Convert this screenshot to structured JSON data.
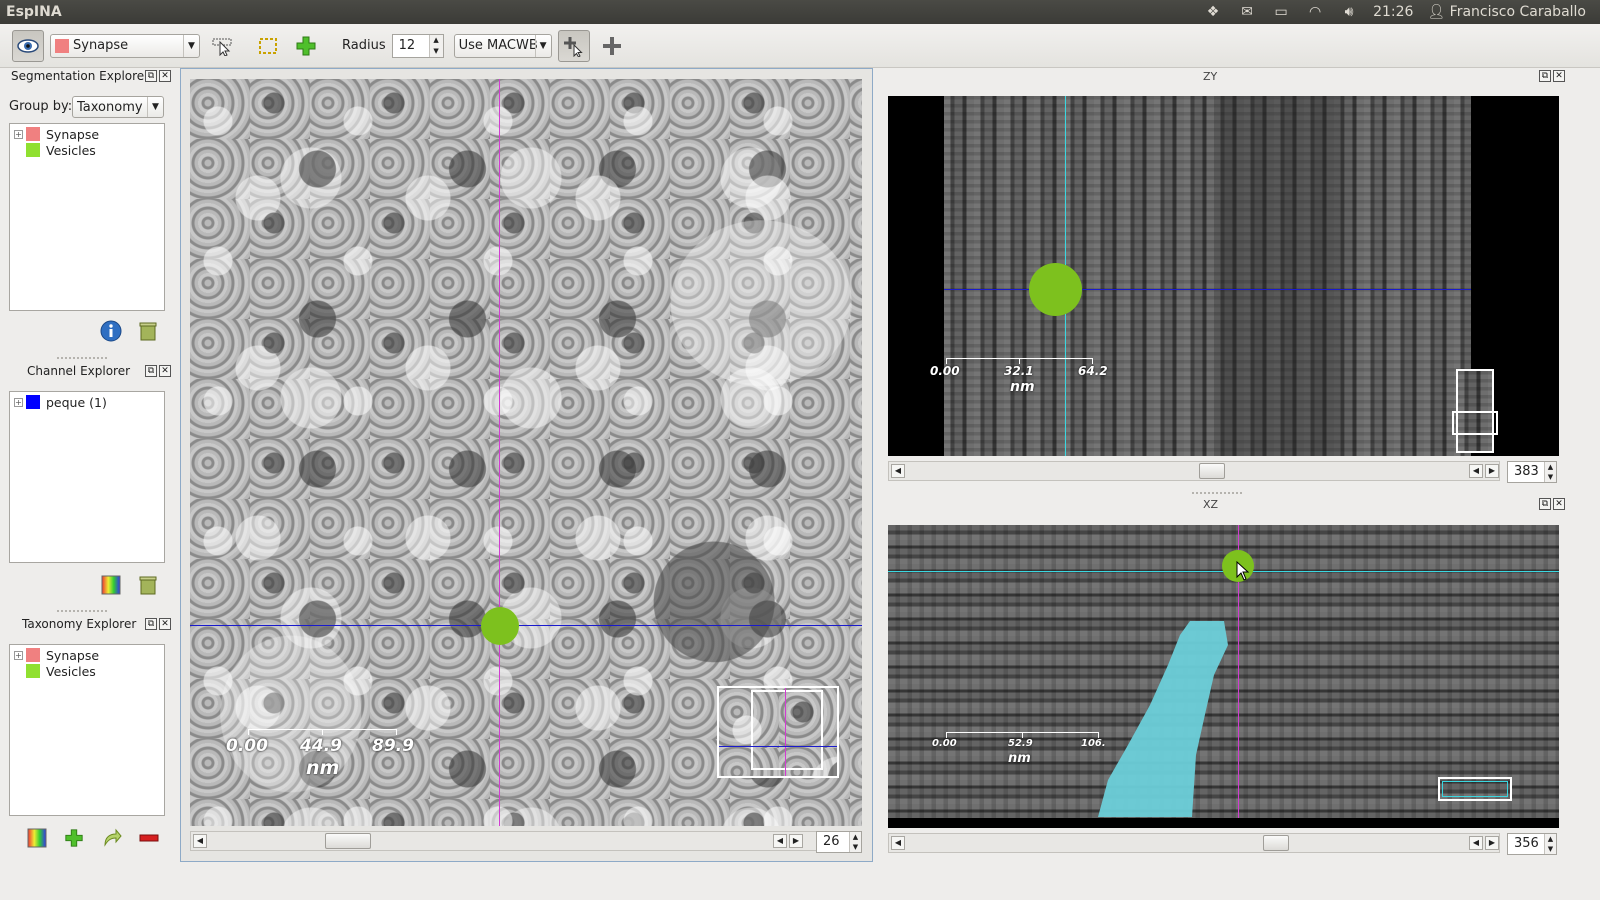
{
  "app": {
    "title": "EspINA"
  },
  "tray": {
    "clock": "21:26",
    "user": "Francisco Caraballo"
  },
  "toolbar": {
    "segmentation_label": "Synapse",
    "segmentation_color": "#f08080",
    "radius_label": "Radius",
    "radius_value": "12",
    "filter_value": "Use MACWB"
  },
  "segmentation_explorer": {
    "title": "Segmentation Explorer",
    "group_by_label": "Group by:",
    "group_by_value": "Taxonomy",
    "items": [
      {
        "label": "Synapse",
        "color": "#f08080"
      },
      {
        "label": "Vesicles",
        "color": "#90e030"
      }
    ]
  },
  "channel_explorer": {
    "title": "Channel Explorer",
    "items": [
      {
        "label": "peque (1)",
        "color": "#0000ff"
      }
    ]
  },
  "taxonomy_explorer": {
    "title": "Taxonomy Explorer",
    "items": [
      {
        "label": "Synapse",
        "color": "#f08080"
      },
      {
        "label": "Vesicles",
        "color": "#90e030"
      }
    ]
  },
  "views": {
    "xy": {
      "slice": "26",
      "scale": [
        "0.00",
        "44.9",
        "89.9"
      ],
      "unit": "nm"
    },
    "zy": {
      "title": "ZY",
      "slice": "383",
      "scale": [
        "0.00",
        "32.1",
        "64.2"
      ],
      "unit": "nm"
    },
    "xz": {
      "title": "XZ",
      "slice": "356",
      "scale": [
        "0.00",
        "52.9",
        "106."
      ],
      "unit": "nm"
    }
  },
  "colors": {
    "segmentation_green": "#7dc11e",
    "segmentation_cyan": "#6ccfd9",
    "crosshair_blue": "#1a1acc",
    "crosshair_magenta": "#d23cd2",
    "crosshair_cyan": "#3ad7e0"
  }
}
